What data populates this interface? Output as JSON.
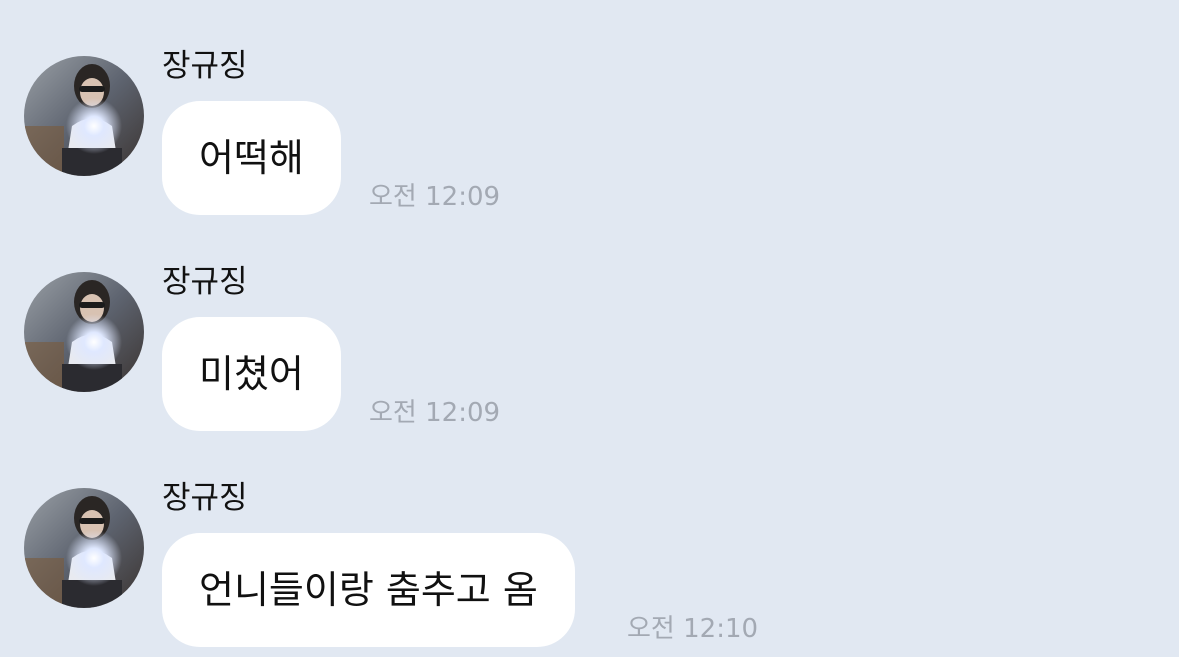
{
  "colors": {
    "background": "#e1e8f2",
    "bubble": "#ffffff",
    "text": "#111111",
    "timestamp": "#a3a9b3"
  },
  "messages": [
    {
      "sender": "장규징",
      "avatar_icon": "profile-photo",
      "text": "어떡해",
      "time": "오전 12:09"
    },
    {
      "sender": "장규징",
      "avatar_icon": "profile-photo",
      "text": "미쳤어",
      "time": "오전 12:09"
    },
    {
      "sender": "장규징",
      "avatar_icon": "profile-photo",
      "text": "언니들이랑 춤추고 옴",
      "time": "오전 12:10"
    }
  ]
}
